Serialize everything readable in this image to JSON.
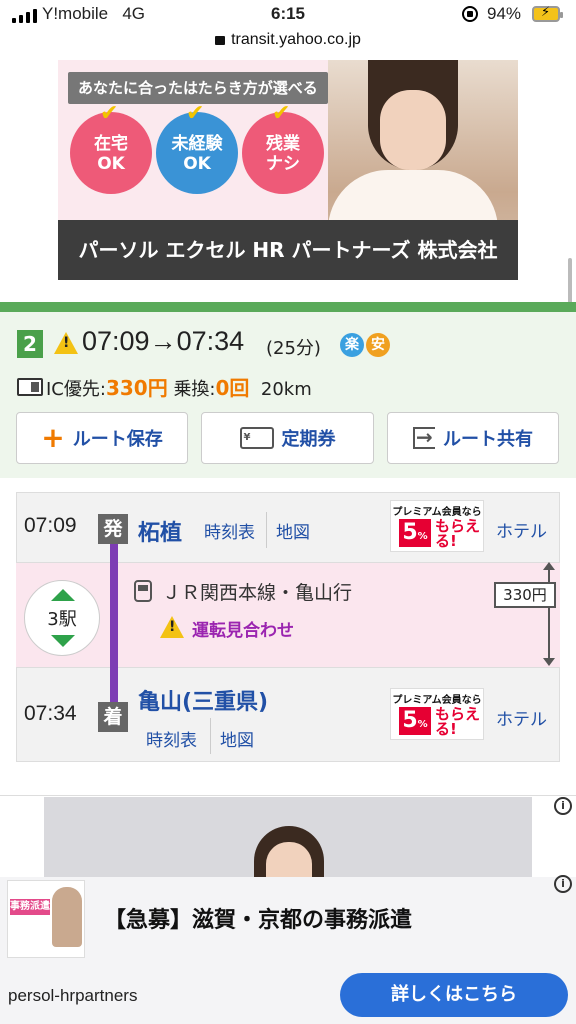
{
  "status_bar": {
    "carrier": "Y!mobile",
    "network": "4G",
    "time": "6:15",
    "battery": "94%",
    "url": "transit.yahoo.co.jp"
  },
  "ad_top": {
    "tagline": "あなたに合ったはたらき方が選べる",
    "badges": [
      "在宅\nOK",
      "未経験\nOK",
      "残業\nナシ"
    ],
    "badge_colors": [
      "#ee5a78",
      "#3a93d6",
      "#ee5a78"
    ],
    "company": "パーソル エクセル HR パートナーズ 株式会社"
  },
  "route": {
    "rank": "2",
    "time": "07:09→07:34",
    "duration": "(25分)",
    "badges": [
      "楽",
      "安"
    ],
    "badge_colors": [
      "#3aa0e0",
      "#f0a020"
    ],
    "ic_label": "IC優先:",
    "fare": "330円",
    "transfer_label": "乗換:",
    "transfers": "0回",
    "distance": "20km",
    "buttons": {
      "save": "ルート保存",
      "teiki": "定期券",
      "share": "ルート共有"
    },
    "teiki_icon_text": "¥"
  },
  "detail": {
    "departure": {
      "time": "07:09",
      "mark": "発",
      "station": "柘植",
      "timetable": "時刻表",
      "map": "地図",
      "hotel": "ホテル"
    },
    "segment": {
      "stations": "3駅",
      "line": "ＪＲ関西本線・亀山行",
      "delay": "運転見合わせ",
      "fare": "330円"
    },
    "arrival": {
      "time": "07:34",
      "mark": "着",
      "station": "亀山(三重県)",
      "timetable": "時刻表",
      "map": "地図",
      "hotel": "ホテル"
    },
    "promo": {
      "top": "プレミアム会員なら",
      "pct": "5",
      "pct_unit": "%",
      "sub": "もらえる!"
    }
  },
  "ad_bottom": {
    "thumb_text": "事務派遣",
    "headline": "【急募】滋賀・京都の事務派遣",
    "domain": "persol-hrpartners",
    "cta": "詳しくはこちら",
    "info_icon": "i"
  }
}
